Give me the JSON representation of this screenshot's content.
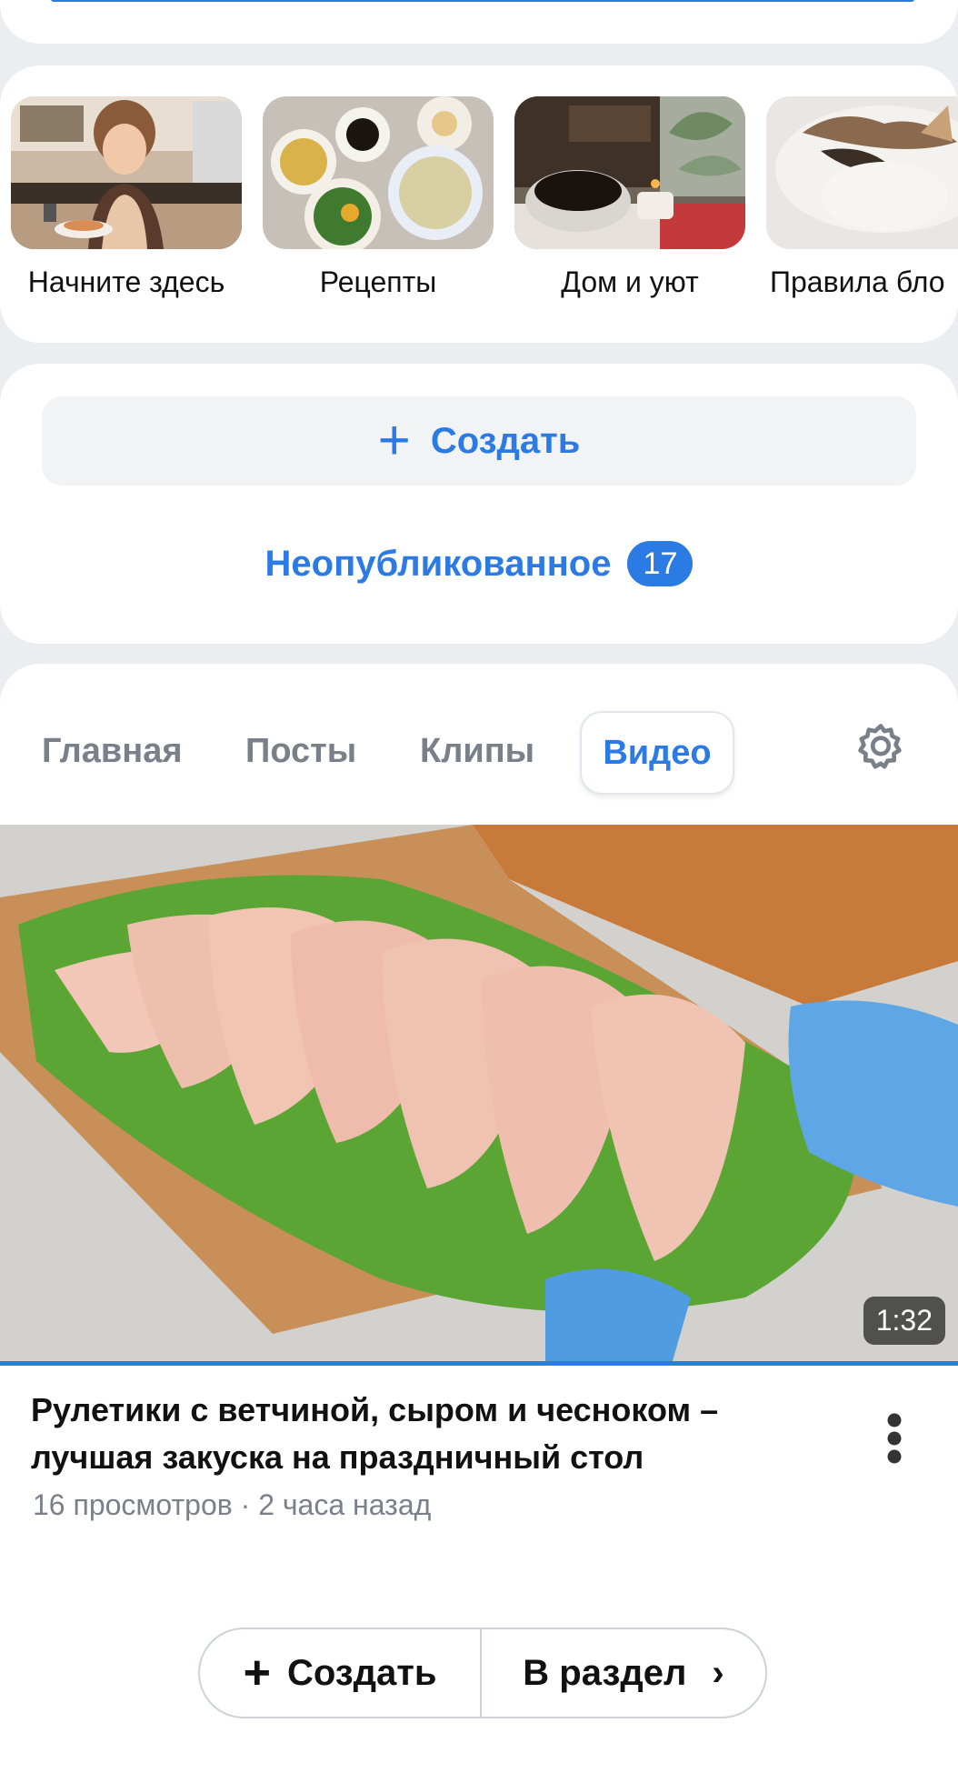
{
  "stories": [
    {
      "label": "Начните здесь"
    },
    {
      "label": "Рецепты"
    },
    {
      "label": "Дом и уют"
    },
    {
      "label": "Правила бло"
    }
  ],
  "create": {
    "label": "Создать",
    "icon": "plus-icon"
  },
  "unpublished": {
    "label": "Неопубликованное",
    "count": "17"
  },
  "tabs": [
    {
      "label": "Главная",
      "active": false
    },
    {
      "label": "Посты",
      "active": false
    },
    {
      "label": "Клипы",
      "active": false
    },
    {
      "label": "Видео",
      "active": true
    }
  ],
  "settings_icon": "gear-icon",
  "video": {
    "duration": "1:32",
    "title": "Рулетики с ветчиной, сыром и чесноком – лучшая закуска на праздничный стол",
    "views": "16 просмотров",
    "separator": "·",
    "time": "2 часа назад"
  },
  "bottom_bar": {
    "create_label": "Создать",
    "section_label": "В раздел"
  },
  "colors": {
    "accent": "#2c7be5",
    "background": "#ebedf0",
    "muted_text": "#7a8089"
  }
}
